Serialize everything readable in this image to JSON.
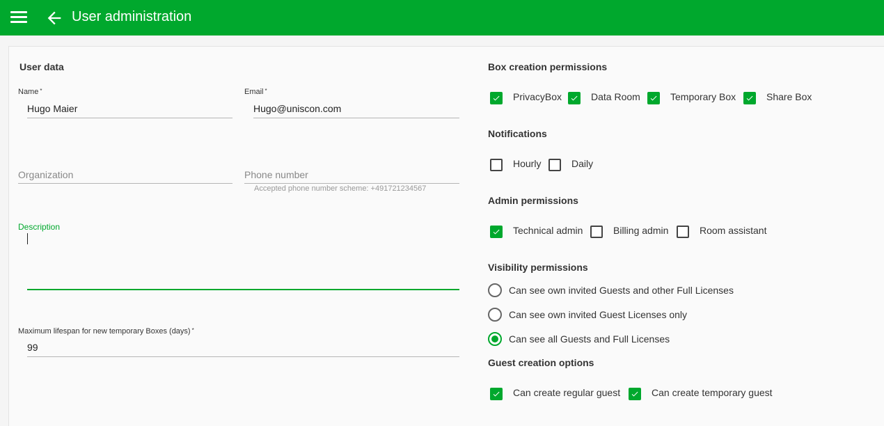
{
  "header": {
    "title": "User administration"
  },
  "user_data": {
    "section_title": "User data",
    "name": {
      "label": "Name",
      "required_mark": "*",
      "value": "Hugo Maier"
    },
    "email": {
      "label": "Email",
      "required_mark": "*",
      "value": "Hugo@uniscon.com"
    },
    "organization": {
      "placeholder": "Organization"
    },
    "phone": {
      "placeholder": "Phone number",
      "hint": "Accepted phone number scheme: +491721234567"
    },
    "description": {
      "label": "Description"
    },
    "lifespan": {
      "label": "Maximum lifespan for new temporary Boxes (days)",
      "required_mark": "*",
      "value": "99"
    }
  },
  "box_creation": {
    "section_title": "Box creation permissions",
    "options": [
      {
        "label": "PrivacyBox",
        "checked": true
      },
      {
        "label": "Data Room",
        "checked": true
      },
      {
        "label": "Temporary Box",
        "checked": true
      },
      {
        "label": "Share Box",
        "checked": true
      }
    ]
  },
  "notifications": {
    "section_title": "Notifications",
    "options": [
      {
        "label": "Hourly",
        "checked": false
      },
      {
        "label": "Daily",
        "checked": false
      }
    ]
  },
  "admin_permissions": {
    "section_title": "Admin permissions",
    "options": [
      {
        "label": "Technical admin",
        "checked": true
      },
      {
        "label": "Billing admin",
        "checked": false
      },
      {
        "label": "Room assistant",
        "checked": false
      }
    ]
  },
  "visibility": {
    "section_title": "Visibility permissions",
    "options": [
      {
        "label": "Can see own invited Guests and other Full Licenses",
        "selected": false
      },
      {
        "label": "Can see own invited Guest Licenses only",
        "selected": false
      },
      {
        "label": "Can see all Guests and Full Licenses",
        "selected": true
      }
    ]
  },
  "guest_creation": {
    "section_title": "Guest creation options",
    "options": [
      {
        "label": "Can create regular guest",
        "checked": true
      },
      {
        "label": "Can create temporary guest",
        "checked": true
      }
    ]
  },
  "colors": {
    "accent": "#00a82d"
  }
}
